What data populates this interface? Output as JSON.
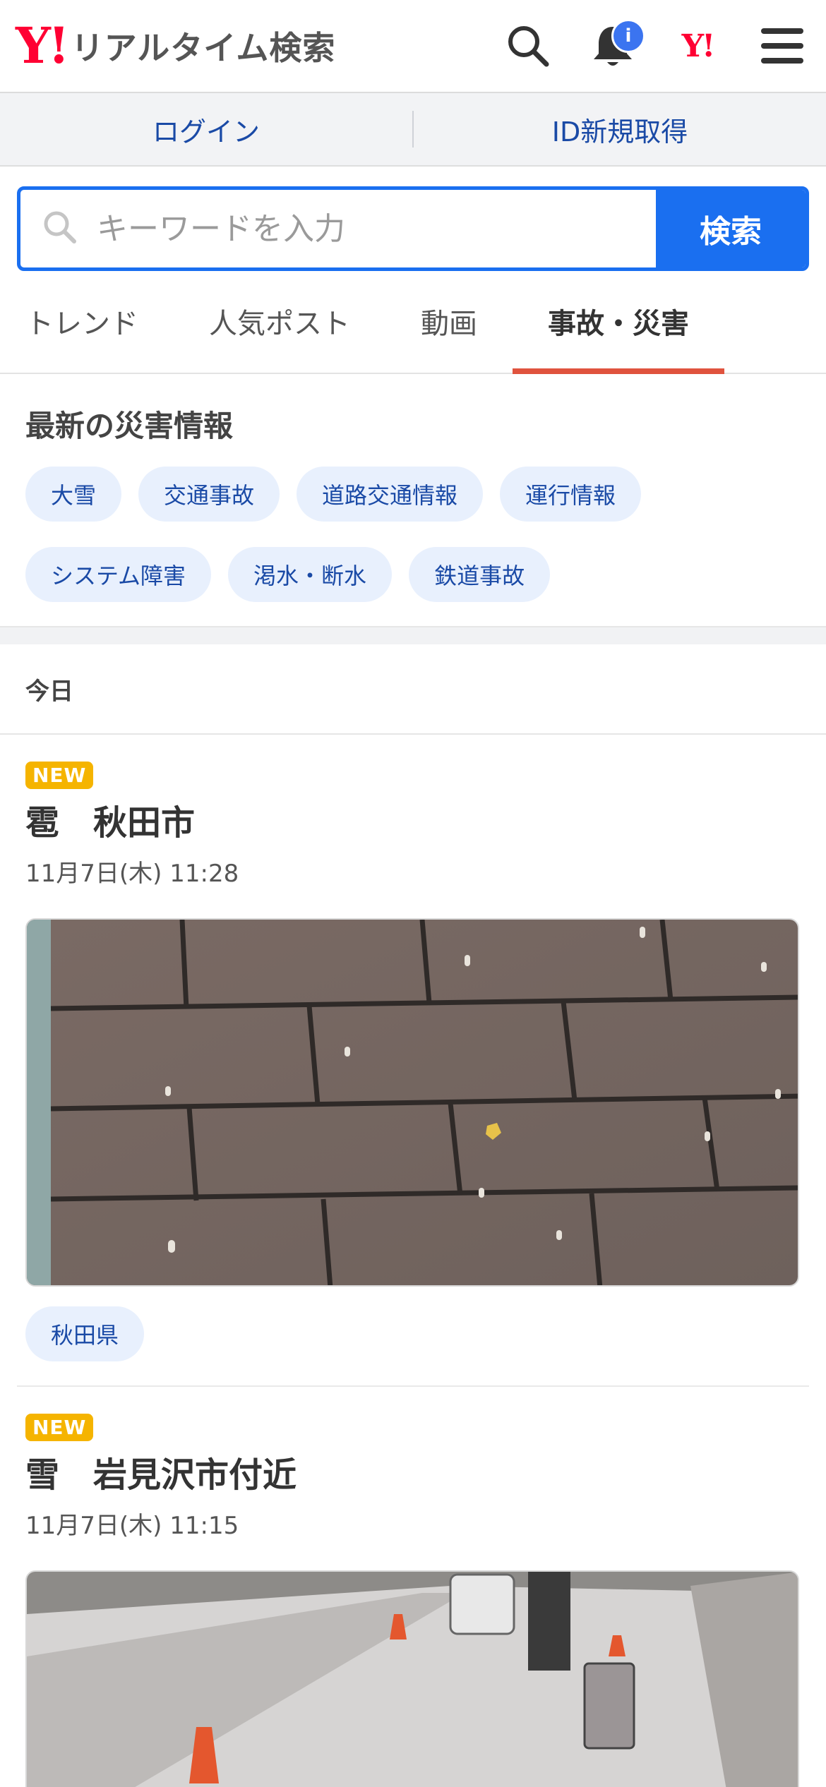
{
  "header": {
    "logo_mark": "Y!",
    "logo_text": "リアルタイム検索",
    "notif_badge": "i",
    "yahoo_mark": "Y!"
  },
  "loginbar": {
    "login": "ログイン",
    "register": "ID新規取得"
  },
  "search": {
    "placeholder": "キーワードを入力",
    "button": "検索"
  },
  "tabs": [
    {
      "label": "トレンド"
    },
    {
      "label": "人気ポスト"
    },
    {
      "label": "動画"
    },
    {
      "label": "事故・災害",
      "active": true
    }
  ],
  "disaster": {
    "title": "最新の災害情報",
    "chips": [
      "大雪",
      "交通事故",
      "道路交通情報",
      "運行情報",
      "システム障害",
      "渇水・断水",
      "鉄道事故"
    ]
  },
  "section_label": "今日",
  "posts": [
    {
      "badge": "NEW",
      "title": "雹　秋田市",
      "time": "11月7日(木) 11:28",
      "tag": "秋田県"
    },
    {
      "badge": "NEW",
      "title": "雪　岩見沢市付近",
      "time": "11月7日(木) 11:15"
    }
  ],
  "colors": {
    "accent_blue": "#1a6ff0",
    "active_tab": "#e0533e",
    "brand_red": "#ff0033",
    "new_badge": "#f5b400"
  }
}
